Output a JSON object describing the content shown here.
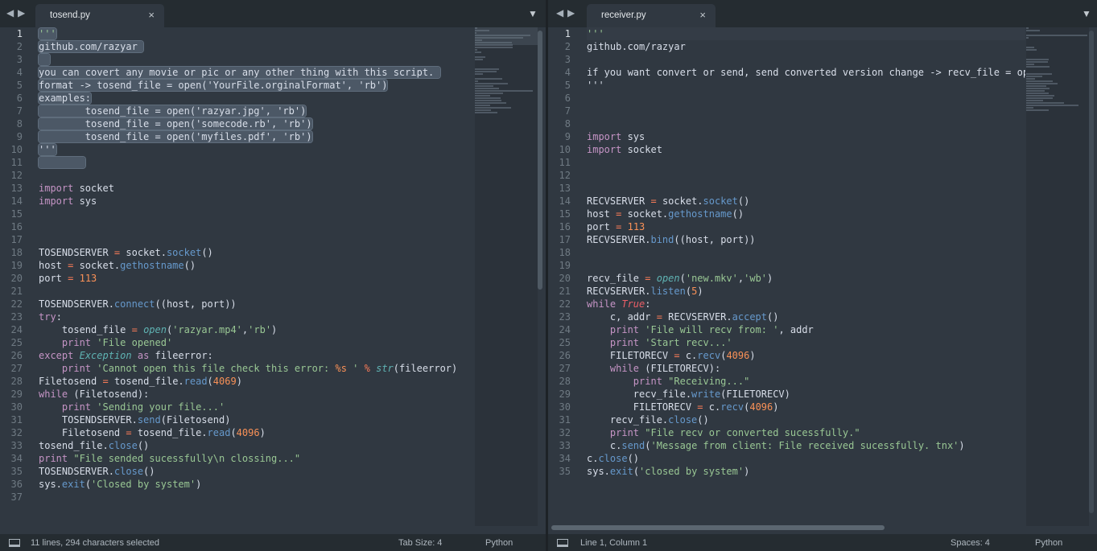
{
  "left": {
    "tab_title": "tosend.py",
    "close_glyph": "×",
    "status": {
      "selection": "11 lines, 294 characters selected",
      "indent": "Tab Size: 4",
      "syntax": "Python"
    },
    "lines": [
      [
        [
          "'''",
          "str"
        ]
      ],
      [
        [
          "github.com/razyar ",
          ""
        ]
      ],
      [
        [
          "  ",
          ""
        ]
      ],
      [
        [
          "you can covert any movie or pic or any other thing with this script. ",
          ""
        ]
      ],
      [
        [
          "format -> tosend_file = open('YourFile.orginalFormat', 'rb')",
          ""
        ]
      ],
      [
        [
          "examples:",
          ""
        ]
      ],
      [
        [
          "        tosend_file = open('razyar.jpg', 'rb')",
          ""
        ]
      ],
      [
        [
          "        tosend_file = open('somecode.rb', 'rb')",
          ""
        ]
      ],
      [
        [
          "        tosend_file = open('myfiles.pdf', 'rb')",
          ""
        ]
      ],
      [
        [
          "'''",
          ""
        ]
      ],
      [
        [
          "        ",
          ""
        ]
      ],
      [],
      [
        [
          "import",
          "kw"
        ],
        [
          " socket",
          ""
        ]
      ],
      [
        [
          "import",
          "kw"
        ],
        [
          " sys",
          ""
        ]
      ],
      [],
      [],
      [],
      [
        [
          "TOSENDSERVER ",
          ""
        ],
        [
          "=",
          "op"
        ],
        [
          " socket.",
          ""
        ],
        [
          "socket",
          "fn"
        ],
        [
          "()",
          ""
        ]
      ],
      [
        [
          "host ",
          ""
        ],
        [
          "=",
          "op"
        ],
        [
          " socket.",
          ""
        ],
        [
          "gethostname",
          "fn"
        ],
        [
          "()",
          ""
        ]
      ],
      [
        [
          "port ",
          ""
        ],
        [
          "=",
          "op"
        ],
        [
          " ",
          ""
        ],
        [
          "113",
          "num"
        ]
      ],
      [],
      [
        [
          "TOSENDSERVER.",
          ""
        ],
        [
          "connect",
          "fn"
        ],
        [
          "((host, port))",
          ""
        ]
      ],
      [
        [
          "try",
          "kw"
        ],
        [
          ":",
          ""
        ]
      ],
      [
        [
          "    tosend_file ",
          ""
        ],
        [
          "=",
          "op"
        ],
        [
          " ",
          ""
        ],
        [
          "open",
          "cls"
        ],
        [
          "(",
          ""
        ],
        [
          "'razyar.mp4'",
          "str"
        ],
        [
          ",",
          ""
        ],
        [
          "'rb'",
          "str"
        ],
        [
          ")",
          ""
        ]
      ],
      [
        [
          "    ",
          ""
        ],
        [
          "print",
          "kw"
        ],
        [
          " ",
          ""
        ],
        [
          "'File opened'",
          "str"
        ]
      ],
      [
        [
          "except",
          "kw"
        ],
        [
          " ",
          ""
        ],
        [
          "Exception",
          "cls"
        ],
        [
          " ",
          ""
        ],
        [
          "as",
          "kw"
        ],
        [
          " fileerror:",
          ""
        ]
      ],
      [
        [
          "    ",
          ""
        ],
        [
          "print",
          "kw"
        ],
        [
          " ",
          ""
        ],
        [
          "'Cannot open this file check this error: ",
          "str"
        ],
        [
          "%s",
          "num"
        ],
        [
          " '",
          "str"
        ],
        [
          " ",
          ""
        ],
        [
          "%",
          "op"
        ],
        [
          " ",
          ""
        ],
        [
          "str",
          "cls"
        ],
        [
          "(fileerror)",
          ""
        ]
      ],
      [
        [
          "Filetosend ",
          ""
        ],
        [
          "=",
          "op"
        ],
        [
          " tosend_file.",
          ""
        ],
        [
          "read",
          "fn"
        ],
        [
          "(",
          ""
        ],
        [
          "4069",
          "num"
        ],
        [
          ")",
          ""
        ]
      ],
      [
        [
          "while",
          "kw"
        ],
        [
          " (Filetosend):",
          ""
        ]
      ],
      [
        [
          "    ",
          ""
        ],
        [
          "print",
          "kw"
        ],
        [
          " ",
          ""
        ],
        [
          "'Sending your file...'",
          "str"
        ]
      ],
      [
        [
          "    TOSENDSERVER.",
          ""
        ],
        [
          "send",
          "fn"
        ],
        [
          "(Filetosend)",
          ""
        ]
      ],
      [
        [
          "    Filetosend ",
          ""
        ],
        [
          "=",
          "op"
        ],
        [
          " tosend_file.",
          ""
        ],
        [
          "read",
          "fn"
        ],
        [
          "(",
          ""
        ],
        [
          "4096",
          "num"
        ],
        [
          ")",
          ""
        ]
      ],
      [
        [
          "tosend_file.",
          ""
        ],
        [
          "close",
          "fn"
        ],
        [
          "()",
          ""
        ]
      ],
      [
        [
          "print",
          "kw"
        ],
        [
          " ",
          ""
        ],
        [
          "\"File sended sucessfully\\n clossing...\"",
          "str"
        ]
      ],
      [
        [
          "TOSENDSERVER.",
          ""
        ],
        [
          "close",
          "fn"
        ],
        [
          "()",
          ""
        ]
      ],
      [
        [
          "sys.",
          ""
        ],
        [
          "exit",
          "fn"
        ],
        [
          "(",
          ""
        ],
        [
          "'Closed by system'",
          "str"
        ],
        [
          ")",
          ""
        ]
      ],
      []
    ]
  },
  "right": {
    "tab_title": "receiver.py",
    "close_glyph": "×",
    "status": {
      "position": "Line 1, Column 1",
      "indent": "Spaces: 4",
      "syntax": "Python"
    },
    "lines": [
      [
        [
          "'''",
          "str"
        ]
      ],
      [
        [
          "github.com/razyar",
          ""
        ]
      ],
      [],
      [
        [
          "if you want convert or send, send converted version change -> recv_file = ope",
          ""
        ]
      ],
      [
        [
          "'''",
          ""
        ]
      ],
      [],
      [],
      [],
      [
        [
          "import",
          "kw"
        ],
        [
          " sys",
          ""
        ]
      ],
      [
        [
          "import",
          "kw"
        ],
        [
          " socket",
          ""
        ]
      ],
      [],
      [],
      [],
      [
        [
          "RECVSERVER ",
          ""
        ],
        [
          "=",
          "op"
        ],
        [
          " socket.",
          ""
        ],
        [
          "socket",
          "fn"
        ],
        [
          "()",
          ""
        ]
      ],
      [
        [
          "host ",
          ""
        ],
        [
          "=",
          "op"
        ],
        [
          " socket.",
          ""
        ],
        [
          "gethostname",
          "fn"
        ],
        [
          "()",
          ""
        ]
      ],
      [
        [
          "port ",
          ""
        ],
        [
          "=",
          "op"
        ],
        [
          " ",
          ""
        ],
        [
          "113",
          "num"
        ]
      ],
      [
        [
          "RECVSERVER.",
          ""
        ],
        [
          "bind",
          "fn"
        ],
        [
          "((host, port))",
          ""
        ]
      ],
      [],
      [],
      [
        [
          "recv_file ",
          ""
        ],
        [
          "=",
          "op"
        ],
        [
          " ",
          ""
        ],
        [
          "open",
          "cls"
        ],
        [
          "(",
          ""
        ],
        [
          "'new.mkv'",
          "str"
        ],
        [
          ",",
          ""
        ],
        [
          "'wb'",
          "str"
        ],
        [
          ")",
          ""
        ]
      ],
      [
        [
          "RECVSERVER.",
          ""
        ],
        [
          "listen",
          "fn"
        ],
        [
          "(",
          ""
        ],
        [
          "5",
          "num"
        ],
        [
          ")",
          ""
        ]
      ],
      [
        [
          "while",
          "kw"
        ],
        [
          " ",
          ""
        ],
        [
          "True",
          "bool"
        ],
        [
          ":",
          ""
        ]
      ],
      [
        [
          "    c, addr ",
          ""
        ],
        [
          "=",
          "op"
        ],
        [
          " RECVSERVER.",
          ""
        ],
        [
          "accept",
          "fn"
        ],
        [
          "()",
          ""
        ]
      ],
      [
        [
          "    ",
          ""
        ],
        [
          "print",
          "kw"
        ],
        [
          " ",
          ""
        ],
        [
          "'File will recv from: '",
          "str"
        ],
        [
          ", addr",
          ""
        ]
      ],
      [
        [
          "    ",
          ""
        ],
        [
          "print",
          "kw"
        ],
        [
          " ",
          ""
        ],
        [
          "'Start recv...'",
          "str"
        ]
      ],
      [
        [
          "    FILETORECV ",
          ""
        ],
        [
          "=",
          "op"
        ],
        [
          " c.",
          ""
        ],
        [
          "recv",
          "fn"
        ],
        [
          "(",
          ""
        ],
        [
          "4096",
          "num"
        ],
        [
          ")",
          ""
        ]
      ],
      [
        [
          "    ",
          ""
        ],
        [
          "while",
          "kw"
        ],
        [
          " (FILETORECV):",
          ""
        ]
      ],
      [
        [
          "        ",
          ""
        ],
        [
          "print",
          "kw"
        ],
        [
          " ",
          ""
        ],
        [
          "\"Receiving...\"",
          "str"
        ]
      ],
      [
        [
          "        recv_file.",
          ""
        ],
        [
          "write",
          "fn"
        ],
        [
          "(FILETORECV)",
          ""
        ]
      ],
      [
        [
          "        FILETORECV ",
          ""
        ],
        [
          "=",
          "op"
        ],
        [
          " c.",
          ""
        ],
        [
          "recv",
          "fn"
        ],
        [
          "(",
          ""
        ],
        [
          "4096",
          "num"
        ],
        [
          ")",
          ""
        ]
      ],
      [
        [
          "    recv_file.",
          ""
        ],
        [
          "close",
          "fn"
        ],
        [
          "()",
          ""
        ]
      ],
      [
        [
          "    ",
          ""
        ],
        [
          "print",
          "kw"
        ],
        [
          " ",
          ""
        ],
        [
          "\"File recv or converted sucessfully.\"",
          "str"
        ]
      ],
      [
        [
          "    c.",
          ""
        ],
        [
          "send",
          "fn"
        ],
        [
          "(",
          ""
        ],
        [
          "'Message from client: File received sucessfully. tnx'",
          "str"
        ],
        [
          ")",
          ""
        ]
      ],
      [
        [
          "c.",
          ""
        ],
        [
          "close",
          "fn"
        ],
        [
          "()",
          ""
        ]
      ],
      [
        [
          "sys.",
          ""
        ],
        [
          "exit",
          "fn"
        ],
        [
          "(",
          ""
        ],
        [
          "'closed by system'",
          "str"
        ],
        [
          ")",
          ""
        ]
      ]
    ]
  },
  "glyphs": {
    "nav_back": "◀",
    "nav_forward": "▶",
    "tab_menu": "▼"
  },
  "colors": {
    "editor_bg": "#303841",
    "tabbar_bg": "#252c31",
    "keyword": "#c594c5",
    "function": "#6699cc",
    "string": "#99c794",
    "number": "#f99157",
    "selection": "#4c5866"
  }
}
